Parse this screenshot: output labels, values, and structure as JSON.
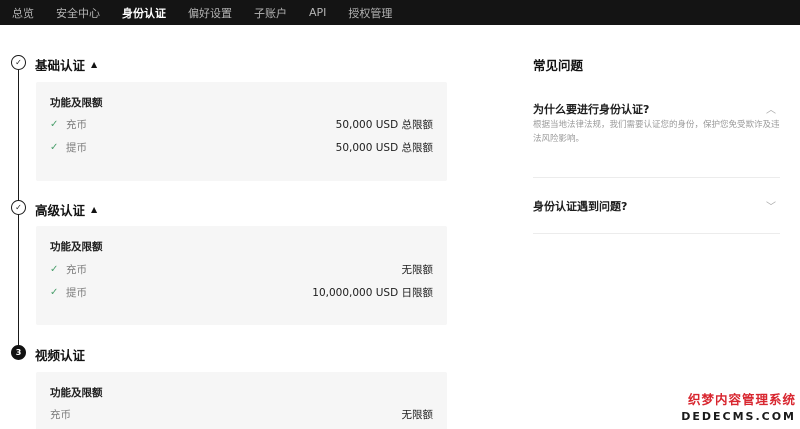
{
  "nav": {
    "items": [
      {
        "label": "总览"
      },
      {
        "label": "安全中心"
      },
      {
        "label": "身份认证"
      },
      {
        "label": "偏好设置"
      },
      {
        "label": "子账户"
      },
      {
        "label": "API"
      },
      {
        "label": "授权管理"
      }
    ],
    "active_index": 2
  },
  "steps": [
    {
      "status": "done",
      "icon": "check-icon",
      "icon_glyph": "✓",
      "title": "基础认证",
      "caret": "▲",
      "card_title": "功能及限额",
      "rows": [
        {
          "label": "充币",
          "value": "50,000 USD 总限额",
          "checked": true
        },
        {
          "label": "提币",
          "value": "50,000 USD 总限额",
          "checked": true
        }
      ]
    },
    {
      "status": "done",
      "icon": "check-icon",
      "icon_glyph": "✓",
      "title": "高级认证",
      "caret": "▲",
      "card_title": "功能及限额",
      "rows": [
        {
          "label": "充币",
          "value": "无限额",
          "checked": true
        },
        {
          "label": "提币",
          "value": "10,000,000 USD 日限额",
          "checked": true
        }
      ]
    },
    {
      "status": "current",
      "icon_glyph": "3",
      "title": "视频认证",
      "card_title": "功能及限额",
      "rows": [
        {
          "label": "充币",
          "value": "无限额",
          "checked": false
        }
      ]
    }
  ],
  "faq": {
    "title": "常见问题",
    "items": [
      {
        "question": "为什么要进行身份认证?",
        "answer": "根据当地法律法规，我们需要认证您的身份，保护您免受欺诈及违法风险影响。",
        "expanded": true,
        "chevron": "︿"
      },
      {
        "question": "身份认证遇到问题?",
        "expanded": false,
        "chevron": "﹀"
      }
    ]
  },
  "watermark": {
    "line1": "织梦内容管理系统",
    "line2": "DEDECMS.COM"
  },
  "colors": {
    "nav_bg": "#141414",
    "check": "#4da06e",
    "card_bg": "#f6f6f6",
    "watermark_red": "#d8262f"
  }
}
